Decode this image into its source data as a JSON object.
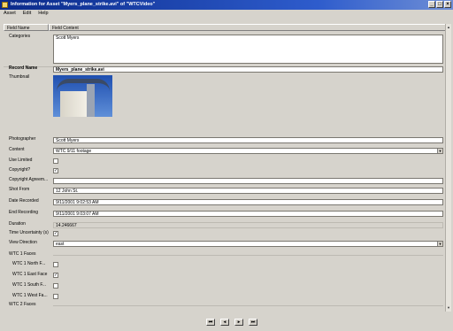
{
  "window": {
    "title": "Information for Asset \"Myers_plane_strike.avi\" of \"WTCVideo\""
  },
  "menu": [
    {
      "label": "Asset"
    },
    {
      "label": "Edit"
    },
    {
      "label": "Help"
    }
  ],
  "columns": {
    "name": "Field Name",
    "content": "Field Content"
  },
  "fields": {
    "categories": {
      "label": "Categories",
      "value": "Scott Myers"
    },
    "record_name": {
      "label": "Record Name",
      "value": "Myers_plane_strike.avi"
    },
    "thumbnail": {
      "label": "Thumbnail"
    },
    "photographer": {
      "label": "Photographer",
      "value": "Scott Myers"
    },
    "content": {
      "label": "Content",
      "value": "WTC 9/11 footage"
    },
    "use_limited": {
      "label": "Use Limited",
      "checked": false
    },
    "copyright": {
      "label": "Copyright?",
      "checked": true
    },
    "copyright_agreem": {
      "label": "Copyright Agreem...",
      "value": ""
    },
    "shot_from": {
      "label": "Shot From",
      "value": "12 John St."
    },
    "date_recorded": {
      "label": "Date Recorded",
      "value": "9/11/2001 9:02:53 AM"
    },
    "end_recording": {
      "label": "End Recording",
      "value": "9/11/2001 9:03:07 AM"
    },
    "duration": {
      "label": "Duration",
      "value": "14.246667"
    },
    "time_uncertainty": {
      "label": "Time Uncertainty (s)",
      "checked": true
    },
    "view_direction": {
      "label": "View Direction",
      "value": "east"
    },
    "wtc1_faces": {
      "label": "WTC 1 Faces"
    },
    "wtc1_north": {
      "label": "WTC 1 North F...",
      "checked": false
    },
    "wtc1_east": {
      "label": "WTC 1 East Face",
      "checked": true
    },
    "wtc1_south": {
      "label": "WTC 1 South F...",
      "checked": false
    },
    "wtc1_west": {
      "label": "WTC 1 West Fa...",
      "checked": false
    },
    "wtc2_faces": {
      "label": "WTC 2 Faces"
    }
  },
  "nav": {
    "first": "⏮",
    "prev": "◂",
    "next": "▸",
    "last": "⏭"
  }
}
